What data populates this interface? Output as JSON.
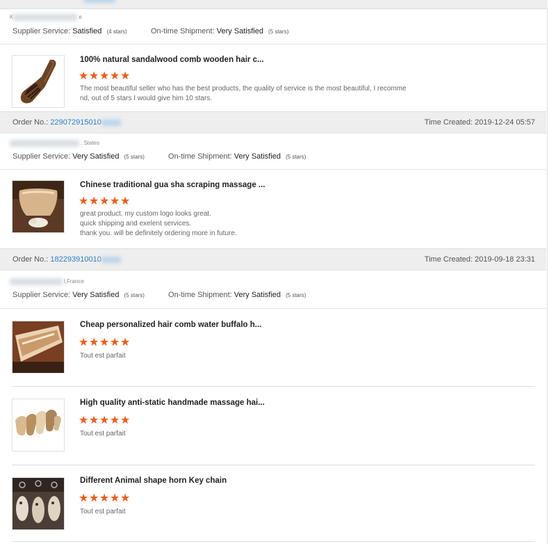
{
  "common": {
    "order_label": "Order No.:",
    "time_label": "Time Created:",
    "supplier_label": "Supplier Service:",
    "shipment_label": "On-time Shipment:"
  },
  "orders": [
    {
      "buyer": "K",
      "buyer_tail": "e",
      "supplier_value": "Satisfied",
      "supplier_count": "(4 stars)",
      "shipment_value": "Very Satisfied",
      "shipment_count": "(5 stars)",
      "products": [
        {
          "title": "100% natural sandalwood comb wooden hair c...",
          "rating": 5,
          "review": [
            "The most beautiful seller who has the best products, the quality of service is the most beautiful, I recomme",
            "nd, out of 5 stars I would give him 10 stars."
          ]
        }
      ]
    },
    {
      "order_no": "229072915010",
      "time_created": "2019-12-24 05:57",
      "buyer_tail": ". States",
      "supplier_value": "Very Satisfied",
      "supplier_count": "(5 stars)",
      "shipment_value": "Very Satisfied",
      "shipment_count": "(5 stars)",
      "products": [
        {
          "title": "Chinese traditional gua sha scraping massage ...",
          "rating": 5,
          "review": [
            "great product. my custom logo looks great.",
            "quick shipping and exelent services.",
            "thank you. will be definitely ordering more in future."
          ]
        }
      ]
    },
    {
      "order_no": "182293910010",
      "time_created": "2019-09-18 23:31",
      "buyer_tail": "l,France",
      "supplier_value": "Very Satisfied",
      "supplier_count": "(5 stars)",
      "shipment_value": "Very Satisfied",
      "shipment_count": "(5 stars)",
      "products": [
        {
          "title": "Cheap personalized hair comb water buffalo h...",
          "rating": 5,
          "review": [
            "Tout est parfait"
          ]
        },
        {
          "title": "High quality anti-static handmade massage hai...",
          "rating": 5,
          "review": [
            "Tout est parfait"
          ]
        },
        {
          "title": "Different Animal shape horn Key chain",
          "rating": 5,
          "review": [
            "Tout est parfait"
          ]
        }
      ]
    }
  ],
  "colors": {
    "star": "#f05c17",
    "link": "#2f7fc4",
    "header_bg": "#eeeeee"
  },
  "icons": {
    "star": "star-icon"
  }
}
